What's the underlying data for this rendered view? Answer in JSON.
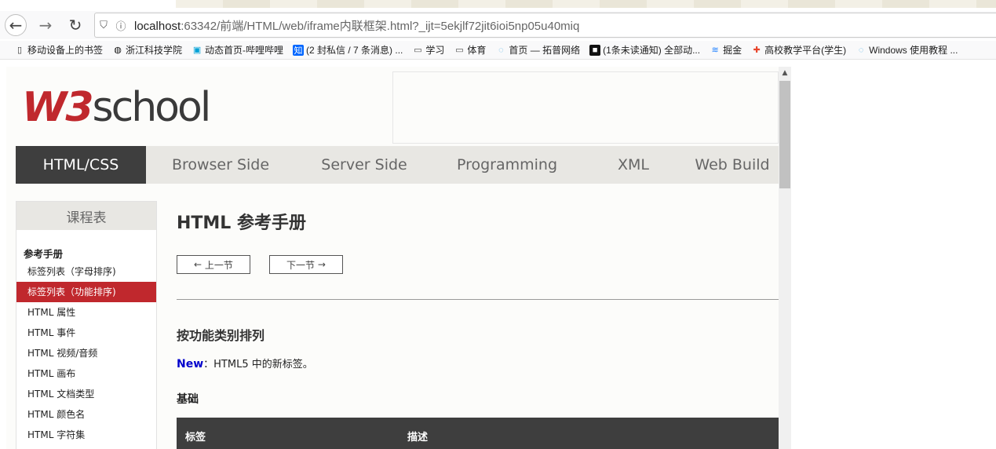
{
  "browser": {
    "url_host": "localhost",
    "url_rest": ":63342/前端/HTML/web/iframe内联框架.html?_ijt=5ekjlf72jit6ioi5np05u40miq",
    "bookmarks": [
      {
        "label": "移动设备上的书签",
        "icon": "mobile-icon"
      },
      {
        "label": "浙江科技学院",
        "icon": "globe-icon"
      },
      {
        "label": "动态首页-哔哩哔哩",
        "icon": "bilibili-icon"
      },
      {
        "label": "(2 封私信 / 7 条消息) ...",
        "icon": "zhihu-icon"
      },
      {
        "label": "学习",
        "icon": "folder-icon"
      },
      {
        "label": "体育",
        "icon": "folder-icon"
      },
      {
        "label": "首页 — 拓普网络",
        "icon": "site-icon"
      },
      {
        "label": "(1条未读通知) 全部动...",
        "icon": "app-icon"
      },
      {
        "label": "掘金",
        "icon": "juejin-icon"
      },
      {
        "label": "高校教学平台(学生)",
        "icon": "cross-icon"
      },
      {
        "label": "Windows 使用教程 ...",
        "icon": "site-icon"
      }
    ]
  },
  "site": {
    "logo_w3": "W3",
    "logo_school": "school",
    "nav": [
      "HTML/CSS",
      "Browser Side",
      "Server Side",
      "Programming",
      "XML",
      "Web Build"
    ],
    "sidebar": {
      "heading": "课程表",
      "section": "参考手册",
      "items": [
        "标签列表（字母排序)",
        "标签列表（功能排序)",
        "HTML 属性",
        "HTML 事件",
        "HTML 视频/音频",
        "HTML 画布",
        "HTML 文档类型",
        "HTML 颜色名",
        "HTML 字符集"
      ]
    },
    "content": {
      "title": "HTML 参考手册",
      "prev": "上一节",
      "next": "下一节",
      "section_title": "按功能类别排列",
      "new_tag": "New",
      "new_desc": "：HTML5 中的新标签。",
      "subsection": "基础",
      "table_headers": [
        "标签",
        "描述"
      ]
    }
  },
  "colors": {
    "brand_red": "#c0282d",
    "nav_dark": "#3e3e3e",
    "new_blue": "#0000cc"
  }
}
